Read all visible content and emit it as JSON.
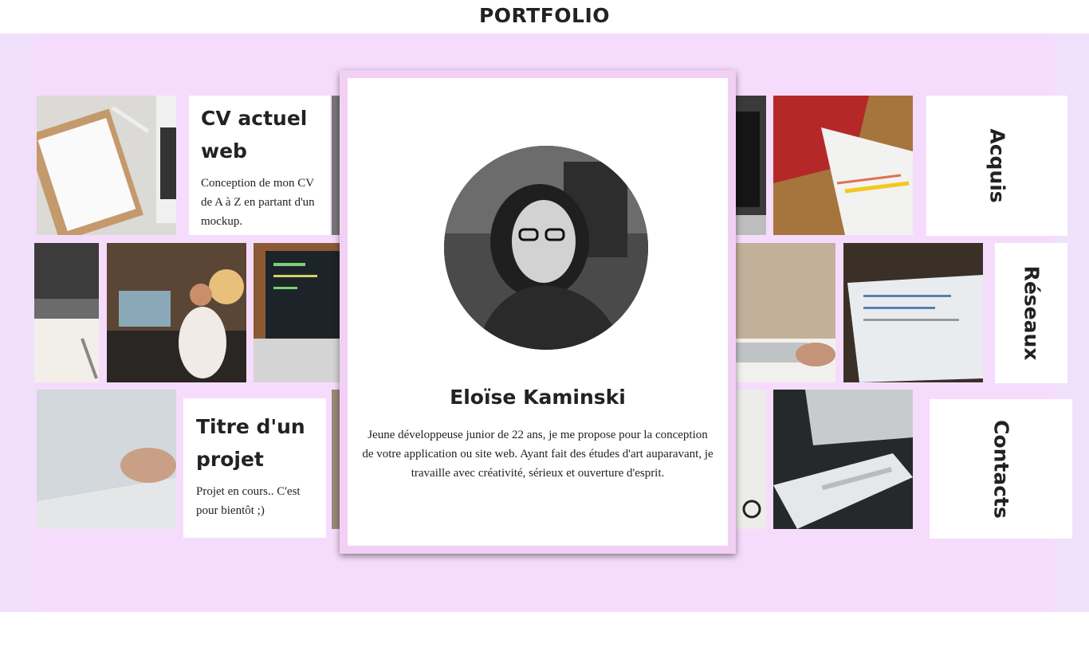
{
  "header": {
    "title": "PORTFOLIO"
  },
  "cards": {
    "cv": {
      "title": "CV actuel web",
      "description": "Conception de mon CV de A à Z en partant d'un mockup."
    },
    "project": {
      "title": "Titre d'un projet",
      "description": "Projet en cours.. C'est pour bientôt ;)"
    }
  },
  "nav": {
    "acquis": "Acquis",
    "reseaux": "Réseaux",
    "contacts": "Contacts"
  },
  "profile": {
    "name": "Eloïse Kaminski",
    "bio": "Jeune développeuse junior de 22 ans, je me propose pour la conception de votre application ou site web. Ayant fait des études d'art auparavant, je travaille avec créativité, sérieux et ouverture d'esprit."
  },
  "colors": {
    "background": "#f6dcfc",
    "card": "#ffffff",
    "text": "#222222"
  }
}
